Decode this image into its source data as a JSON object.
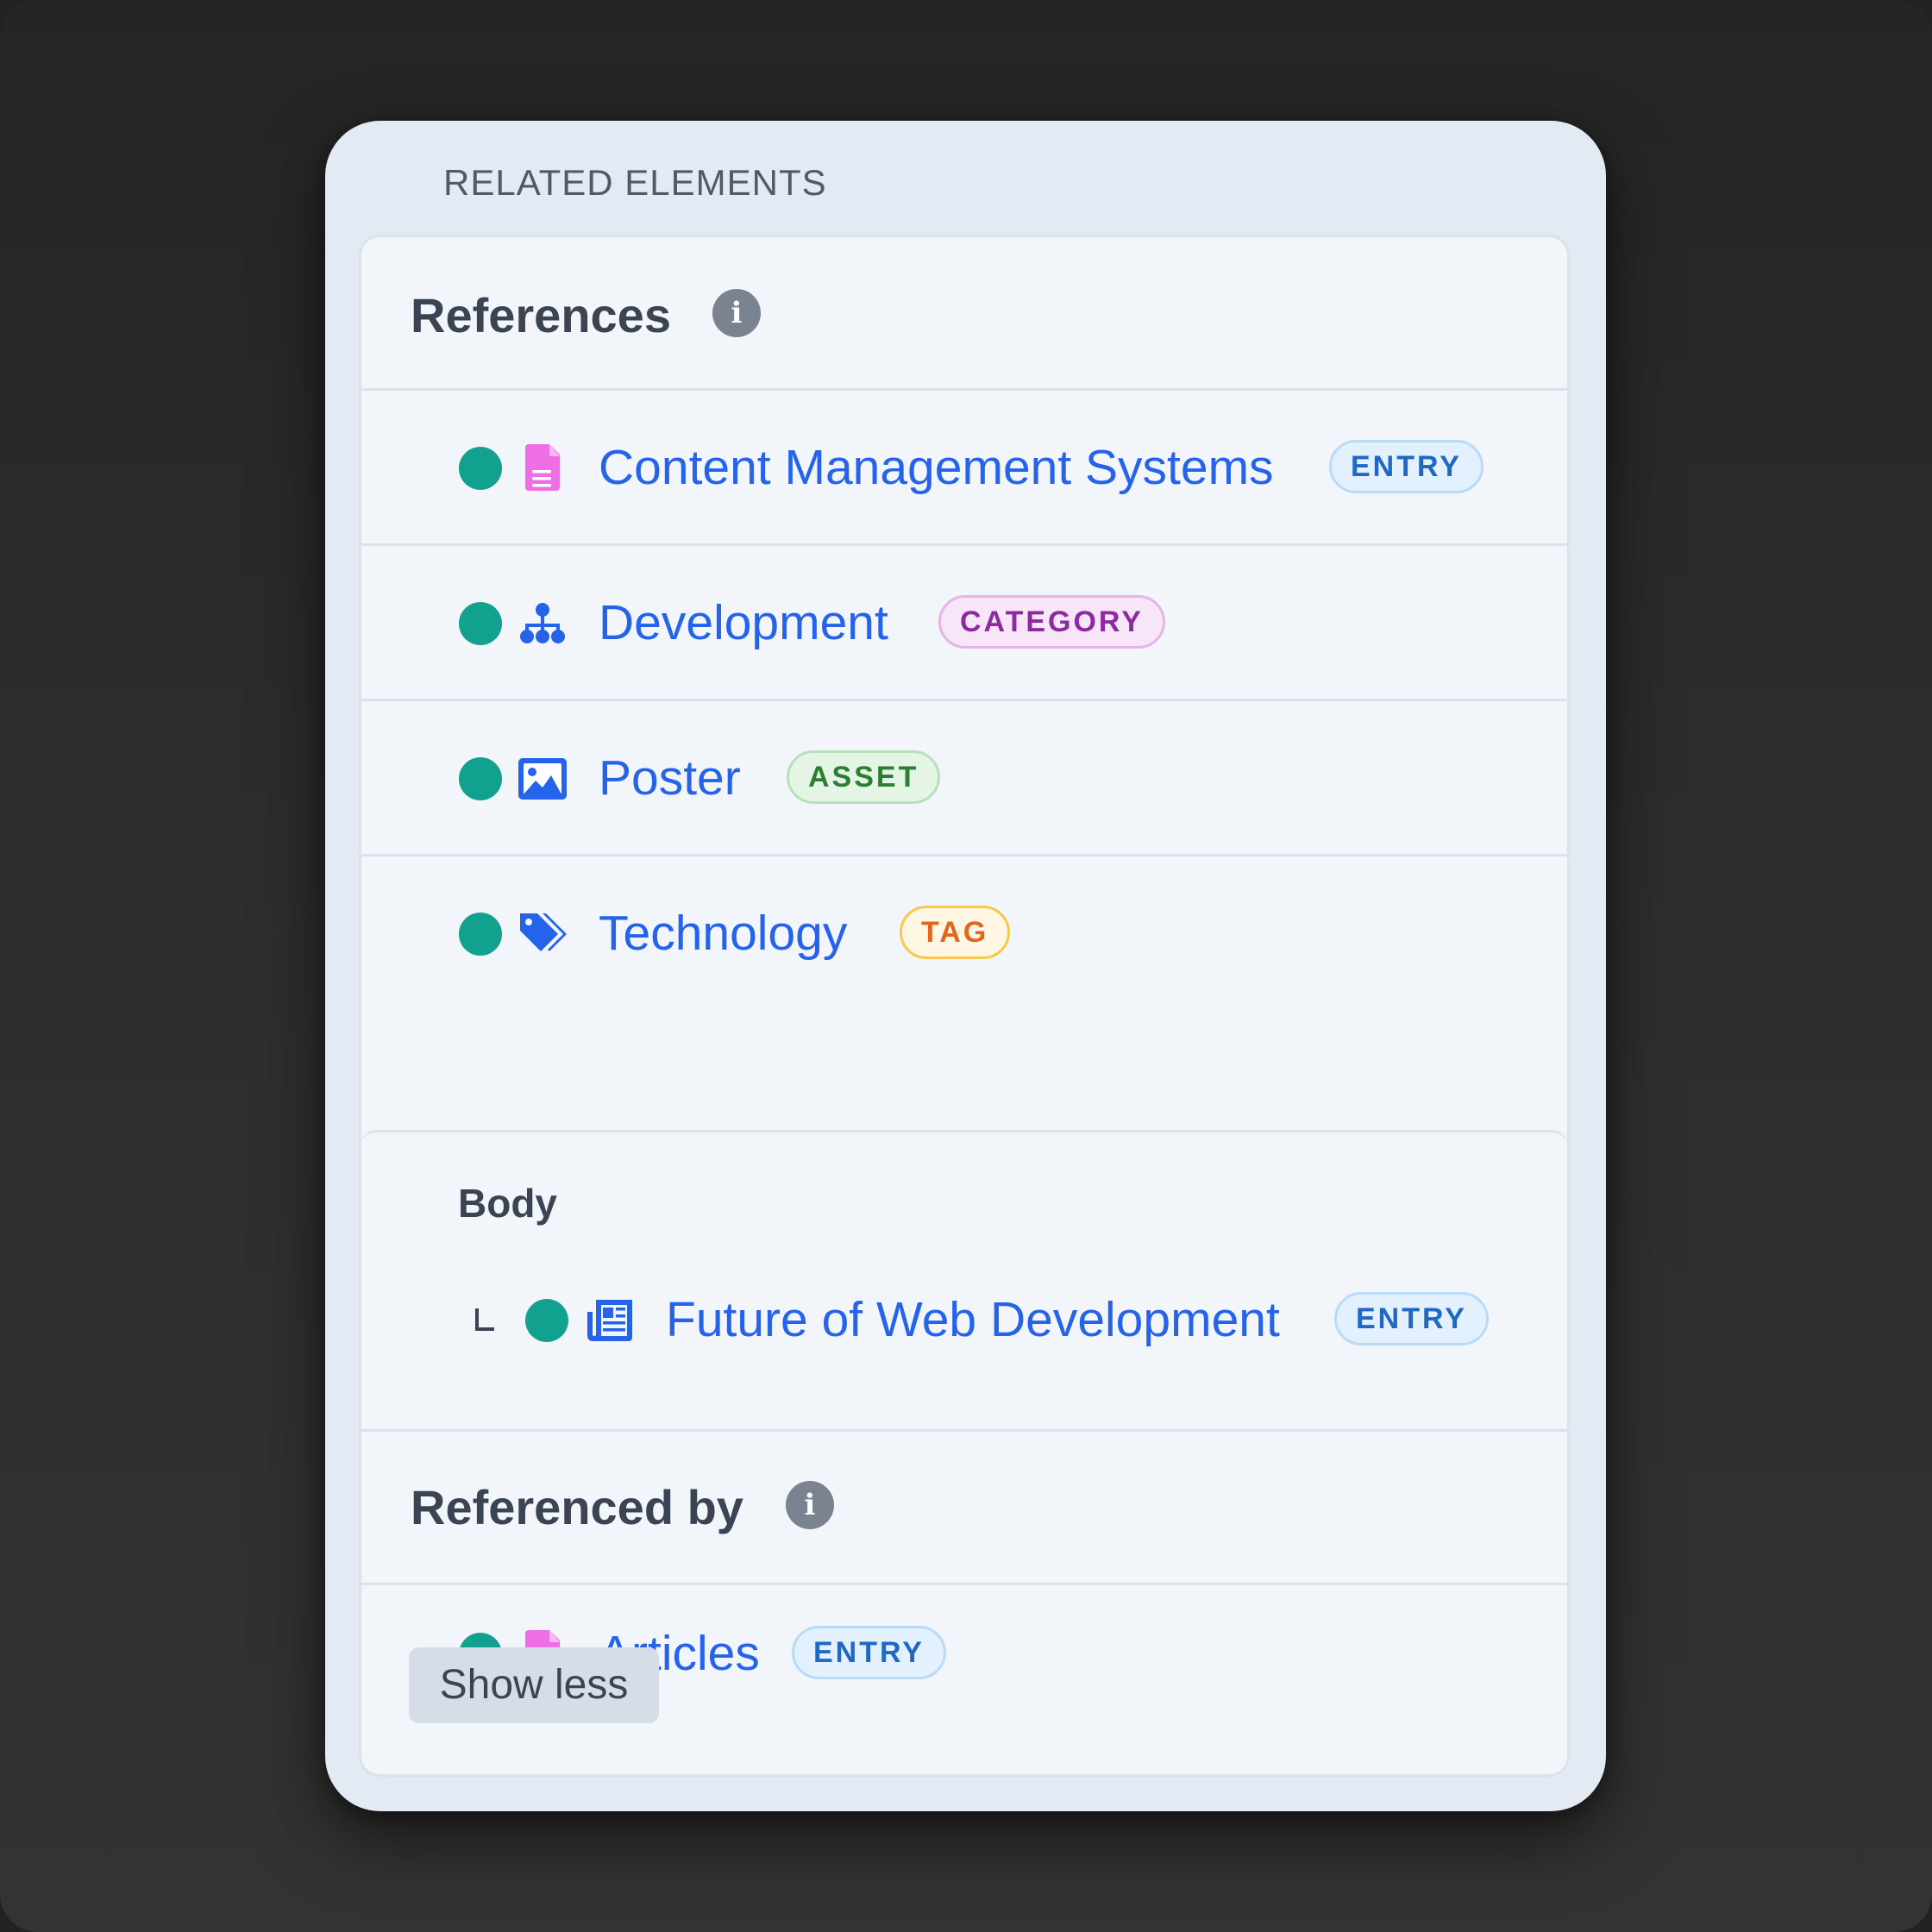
{
  "panel": {
    "title": "RELATED ELEMENTS"
  },
  "references": {
    "heading": "References",
    "info_icon": "i",
    "items": [
      {
        "label": "Content Management Systems",
        "type": "ENTRY",
        "icon": "document-icon",
        "status_color": "#12a18e"
      },
      {
        "label": "Development",
        "type": "CATEGORY",
        "icon": "hierarchy-icon",
        "status_color": "#12a18e"
      },
      {
        "label": "Poster",
        "type": "ASSET",
        "icon": "image-icon",
        "status_color": "#12a18e"
      },
      {
        "label": "Technology",
        "type": "TAG",
        "icon": "tags-icon",
        "status_color": "#12a18e"
      }
    ]
  },
  "body_section": {
    "label": "Body",
    "items": [
      {
        "label": "Future of Web Development",
        "type": "ENTRY",
        "icon": "newspaper-icon",
        "status_color": "#12a18e"
      }
    ]
  },
  "referenced_by": {
    "heading": "Referenced by",
    "info_icon": "i",
    "items": [
      {
        "label": "Articles",
        "type": "ENTRY",
        "icon": "document-icon",
        "status_color": "#12a18e"
      }
    ]
  },
  "actions": {
    "show_less": "Show less"
  },
  "colors": {
    "link": "#2563eb",
    "status_live": "#12a18e",
    "entry_badge": "#2168c4",
    "category_badge": "#8e2aa0",
    "asset_badge": "#2d7d32",
    "tag_badge": "#e2661e"
  }
}
